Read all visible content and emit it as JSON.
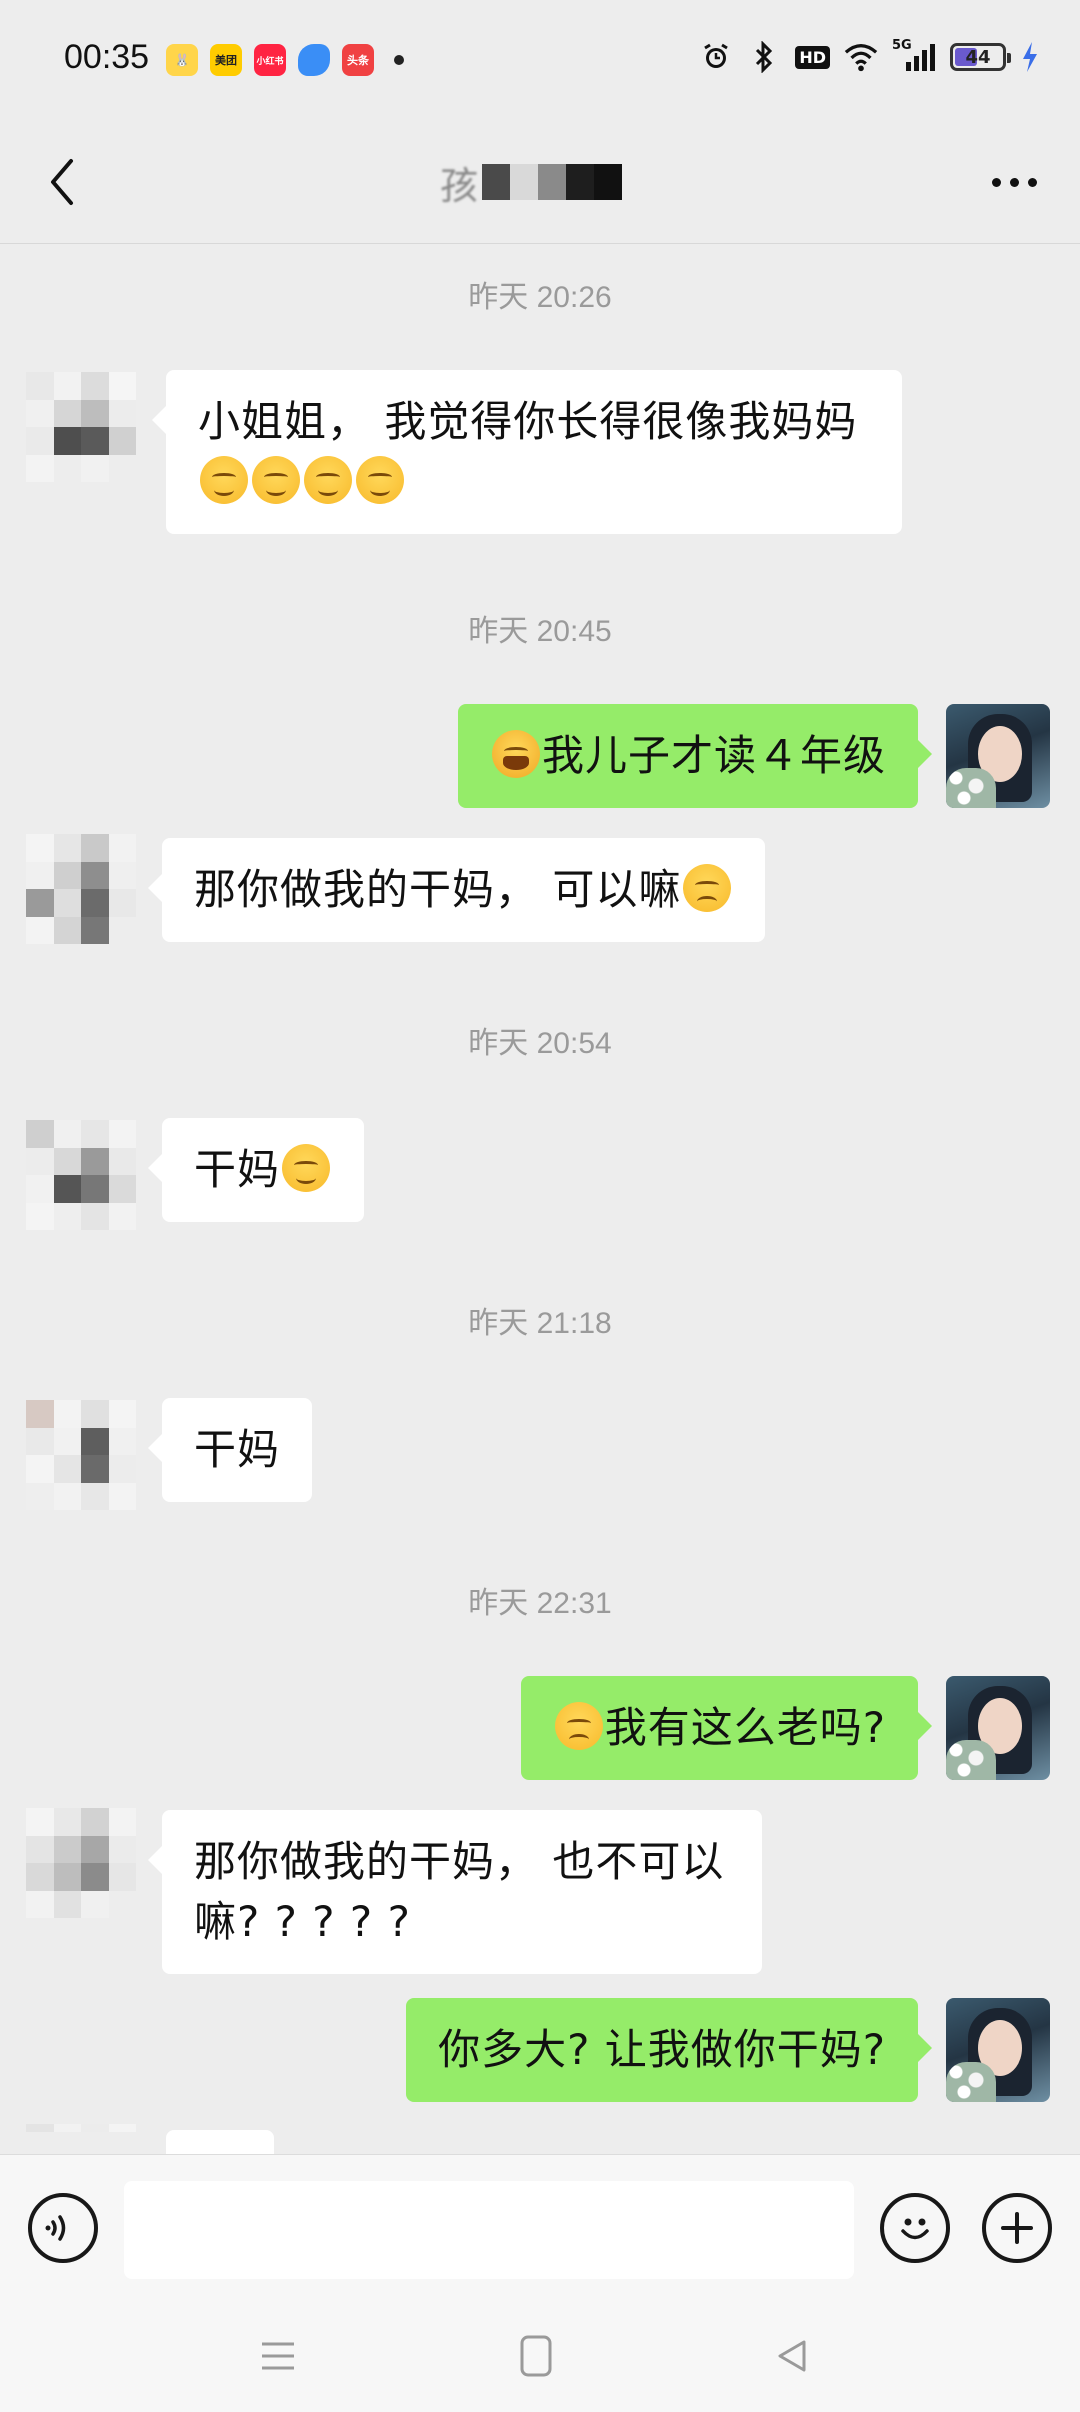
{
  "status_bar": {
    "time": "00:35",
    "apps": [
      {
        "name": "bunny-app-icon",
        "label": "",
        "color": "#ffd54a"
      },
      {
        "name": "meituan-icon",
        "label": "美团",
        "color": "#ffcc00"
      },
      {
        "name": "xiaohongshu-icon",
        "label": "小红书",
        "color": "#ff2442"
      },
      {
        "name": "blue-app-icon",
        "label": "",
        "color": "#3a8ef6"
      },
      {
        "name": "toutiao-icon",
        "label": "头条",
        "color": "#f04142"
      }
    ],
    "network": "5G",
    "hd": "HD",
    "battery": "44",
    "battery_level": 0.44
  },
  "header": {
    "title_visible_char": "孩"
  },
  "messages": [
    {
      "type": "time",
      "text": "昨天 20:26"
    },
    {
      "type": "left",
      "text": "小姐姐， 我觉得你长得很像我妈妈",
      "emojis": [
        "smile-emoji",
        "smile-emoji",
        "smile-emoji",
        "smile-emoji"
      ]
    },
    {
      "type": "time",
      "text": "昨天 20:45"
    },
    {
      "type": "right",
      "text": "我儿子才读４年级",
      "emoji_before": "crying-emoji"
    },
    {
      "type": "left",
      "text": "那你做我的干妈， 可以嘛",
      "emoji_after": "sad-emoji"
    },
    {
      "type": "time",
      "text": "昨天 20:54"
    },
    {
      "type": "left",
      "text": "干妈",
      "emoji_after": "smile-emoji"
    },
    {
      "type": "time",
      "text": "昨天 21:18"
    },
    {
      "type": "left",
      "text": "干妈"
    },
    {
      "type": "time",
      "text": "昨天 22:31"
    },
    {
      "type": "right",
      "text": "我有这么老吗?",
      "emoji_before": "sad-emoji"
    },
    {
      "type": "left",
      "text_line1": "那你做我的干妈， 也不可以",
      "text_line2": "嘛? ? ? ? ?"
    },
    {
      "type": "right",
      "text": "你多大? 让我做你干妈?"
    }
  ],
  "input": {
    "value": "",
    "placeholder": ""
  }
}
